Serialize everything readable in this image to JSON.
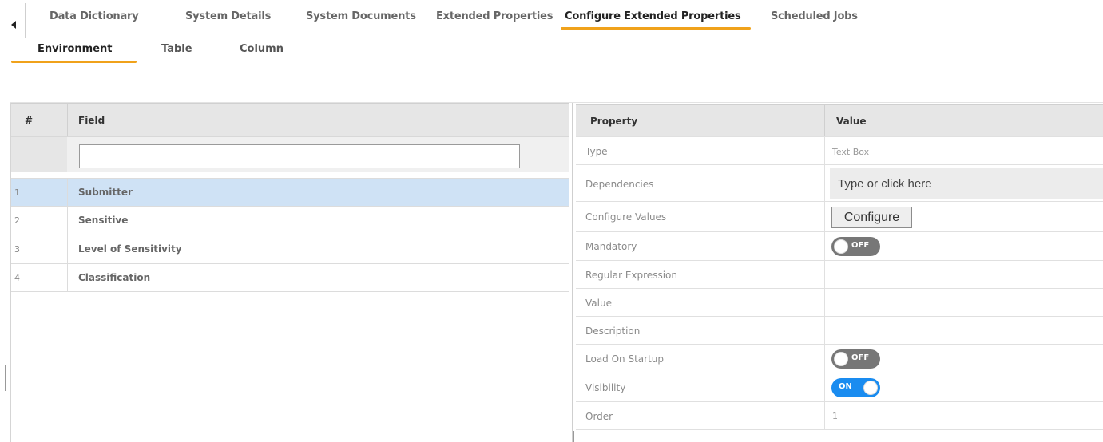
{
  "top_tabs": [
    {
      "label": "Data Dictionary"
    },
    {
      "label": "System Details"
    },
    {
      "label": "System Documents"
    },
    {
      "label": "Extended Properties"
    },
    {
      "label": "Configure Extended Properties",
      "active": true
    },
    {
      "label": "Scheduled Jobs"
    }
  ],
  "sub_tabs": [
    {
      "label": "Environment",
      "active": true
    },
    {
      "label": "Table"
    },
    {
      "label": "Column"
    }
  ],
  "field_grid": {
    "headers": {
      "num": "#",
      "field": "Field"
    },
    "filter_value": "",
    "rows": [
      {
        "num": "1",
        "field": "Submitter",
        "selected": true
      },
      {
        "num": "2",
        "field": "Sensitive"
      },
      {
        "num": "3",
        "field": "Level of Sensitivity"
      },
      {
        "num": "4",
        "field": "Classification"
      }
    ]
  },
  "property_grid": {
    "headers": {
      "property": "Property",
      "value": "Value"
    },
    "rows": {
      "type": {
        "label": "Type",
        "value": "Text Box"
      },
      "dependencies": {
        "label": "Dependencies",
        "placeholder": "Type or click here"
      },
      "configure_values": {
        "label": "Configure Values",
        "button": "Configure"
      },
      "mandatory": {
        "label": "Mandatory",
        "toggle": "OFF"
      },
      "regular_expression": {
        "label": "Regular Expression",
        "value": ""
      },
      "value": {
        "label": "Value",
        "value": ""
      },
      "description": {
        "label": "Description",
        "value": ""
      },
      "load_on_startup": {
        "label": "Load On Startup",
        "toggle": "OFF"
      },
      "visibility": {
        "label": "Visibility",
        "toggle": "ON"
      },
      "order": {
        "label": "Order",
        "value": "1"
      }
    }
  },
  "colors": {
    "accent": "#f0a21b",
    "toggle_on": "#1a8cf0",
    "toggle_off": "#777777",
    "selected_row": "#cfe2f5"
  },
  "icons": {
    "back": "left-arrow-icon"
  }
}
